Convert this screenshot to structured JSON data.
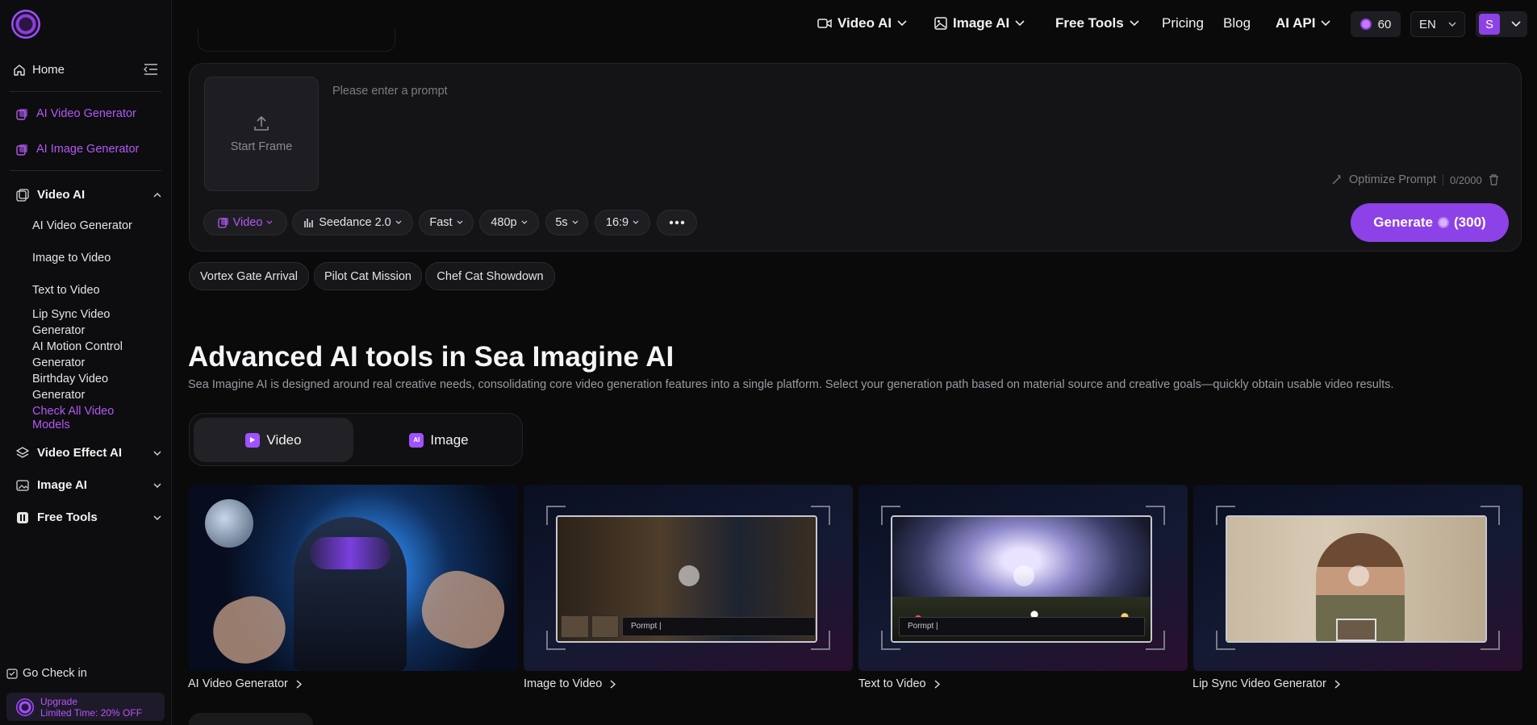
{
  "colors": {
    "accent": "#8c42e6",
    "accent_text": "#b358f5",
    "bg": "#0a0a0b"
  },
  "sidebar": {
    "home": "Home",
    "links": [
      "AI Video Generator",
      "AI Image Generator"
    ],
    "video_ai": {
      "label": "Video AI",
      "items": [
        "AI Video Generator",
        "Image to Video",
        "Text to Video",
        "Lip Sync Video Generator",
        "AI Motion Control Generator",
        "Birthday Video Generator"
      ],
      "check_all": "Check All Video Models"
    },
    "sections": [
      "Video Effect AI",
      "Image AI",
      "Free Tools"
    ],
    "check_in": "Go Check in",
    "upgrade": {
      "title": "Upgrade",
      "subtitle": "Limited Time: 20% OFF"
    }
  },
  "nav": {
    "video_ai": "Video AI",
    "image_ai": "Image AI",
    "free_tools": "Free Tools",
    "pricing": "Pricing",
    "blog": "Blog",
    "ai_api": "AI API",
    "credits": "60",
    "lang": "EN",
    "avatar": "S"
  },
  "prompt": {
    "start_frame": "Start Frame",
    "placeholder": "Please enter a prompt",
    "optimize": "Optimize Prompt",
    "count": "0/2000",
    "mode": "Video",
    "model": "Seedance 2.0",
    "speed": "Fast",
    "resolution": "480p",
    "duration": "5s",
    "ratio": "16:9",
    "generate": "Generate",
    "cost": "(300)"
  },
  "suggestions": [
    "Vortex Gate Arrival",
    "Pilot Cat Mission",
    "Chef Cat Showdown"
  ],
  "section": {
    "title": "Advanced AI tools in Sea Imagine AI",
    "subtitle": "Sea Imagine AI is designed around real creative needs, consolidating core video generation features into a single platform. Select your generation path based on material source and creative goals—quickly obtain usable video results.",
    "tab_video": "Video",
    "tab_image": "Image",
    "tab_image_icon_text": "AI"
  },
  "cards": [
    {
      "label": "AI Video Generator"
    },
    {
      "label": "Image to Video",
      "prompt_text": "Pormpt  |"
    },
    {
      "label": "Text to Video",
      "prompt_text": "Pormpt  |"
    },
    {
      "label": "Lip Sync Video Generator"
    }
  ]
}
